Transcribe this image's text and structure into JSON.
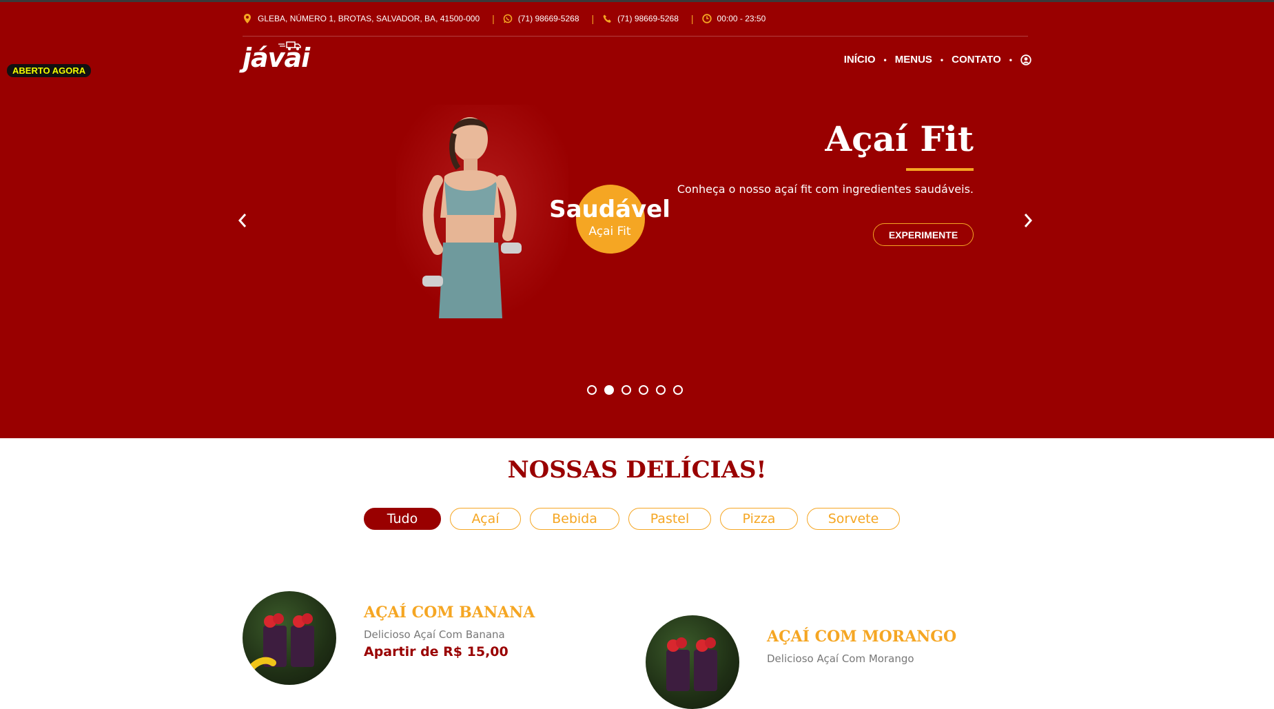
{
  "topbar": {
    "address": "GLEBA, NÚMERO 1, BROTAS, SALVADOR, BA, 41500-000",
    "whatsapp": "(71) 98669-5268",
    "phone": "(71) 98669-5268",
    "hours": "00:00 - 23:50",
    "separator": "|"
  },
  "status_badge": "ABERTO AGORA",
  "logo": "jávai",
  "nav": {
    "items": [
      {
        "label": "INÍCIO"
      },
      {
        "label": "MENUS"
      },
      {
        "label": "CONTATO"
      }
    ],
    "dot": "•"
  },
  "slide": {
    "badge_title": "Saudável",
    "badge_subtitle": "Açai Fit",
    "title": "Açaí Fit",
    "description": "Conheça o nosso açaí fit com ingredientes saudáveis.",
    "cta": "EXPERIMENTE",
    "total_slides": 6,
    "active_slide": 2
  },
  "section": {
    "title": "NOSSAS DELÍCIAS!"
  },
  "filters": [
    "Tudo",
    "Açaí",
    "Bebida",
    "Pastel",
    "Pizza",
    "Sorvete"
  ],
  "products": [
    {
      "name": "AÇAÍ COM BANANA",
      "description": "Delicioso Açaí Com Banana",
      "price": "Apartir de R$ 15,00"
    },
    {
      "name": "AÇAÍ COM MORANGO",
      "description": "Delicioso Açaí Com Morango",
      "price": ""
    }
  ],
  "colors": {
    "brand_red": "#990000",
    "accent_yellow": "#f5a623",
    "badge_text": "#f4ff00"
  },
  "icons": [
    "map-pin-icon",
    "whatsapp-icon",
    "phone-icon",
    "clock-icon",
    "user-icon",
    "chevron-left-icon",
    "chevron-right-icon"
  ]
}
